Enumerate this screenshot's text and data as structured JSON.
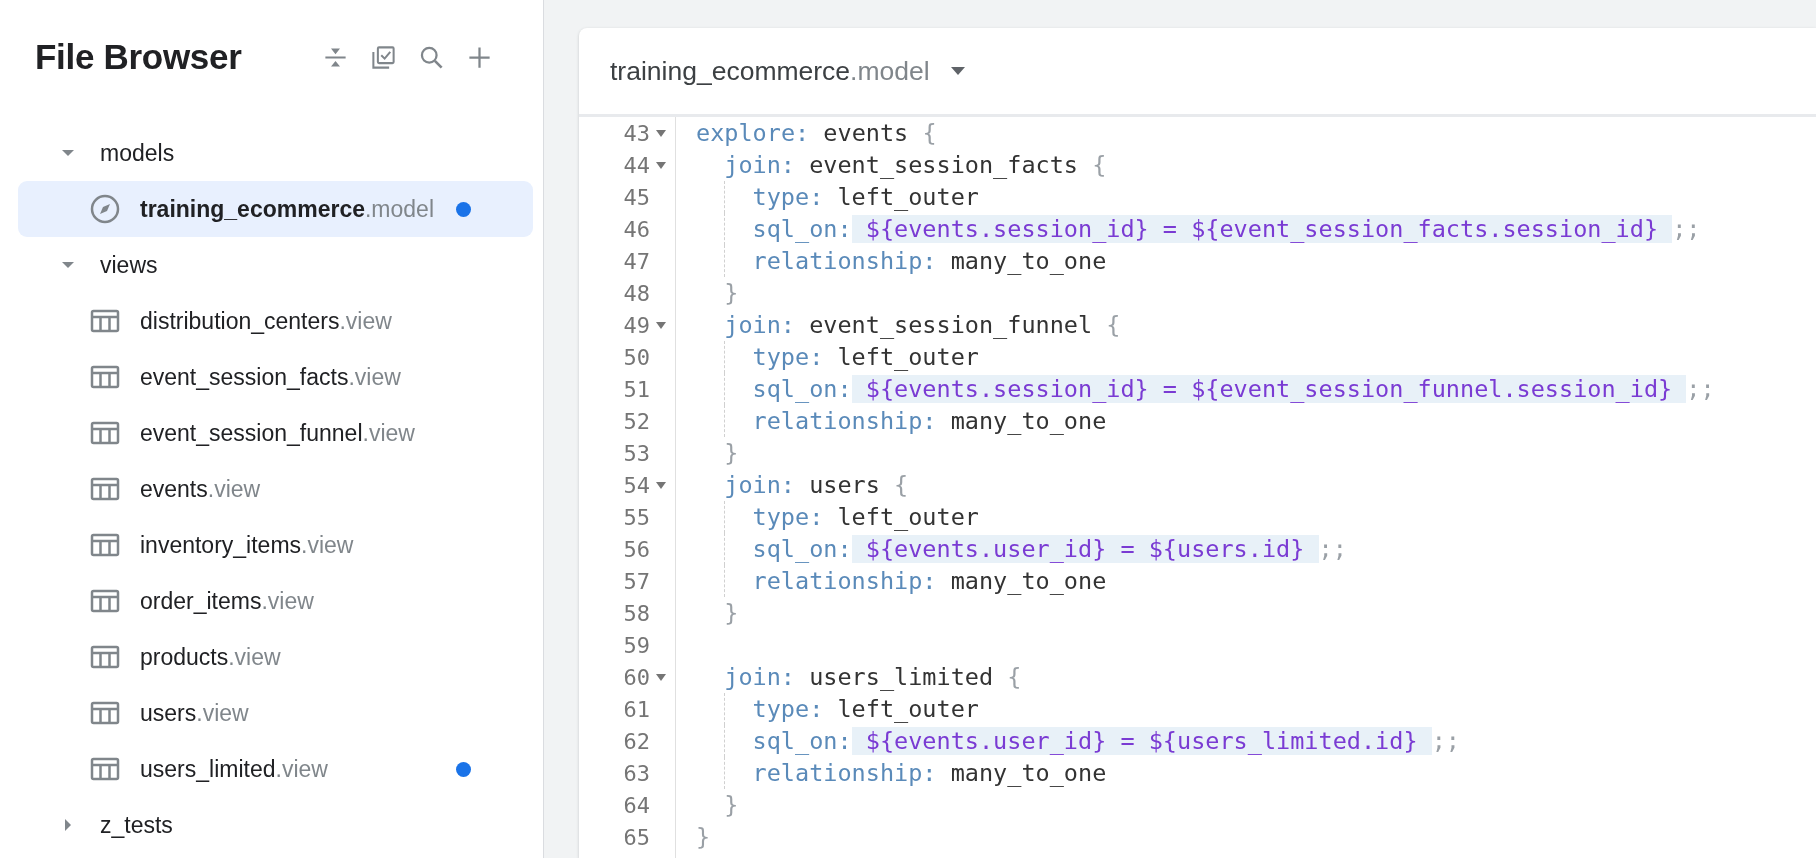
{
  "sidebar": {
    "title": "File Browser",
    "folders": [
      {
        "name": "models",
        "expanded": true,
        "children": [
          {
            "kind": "model",
            "name": "training_ecommerce",
            "extension": ".model",
            "selected": true,
            "modified": true
          }
        ]
      },
      {
        "name": "views",
        "expanded": true,
        "children": [
          {
            "kind": "view",
            "name": "distribution_centers",
            "extension": ".view",
            "selected": false,
            "modified": false
          },
          {
            "kind": "view",
            "name": "event_session_facts",
            "extension": ".view",
            "selected": false,
            "modified": false
          },
          {
            "kind": "view",
            "name": "event_session_funnel",
            "extension": ".view",
            "selected": false,
            "modified": false
          },
          {
            "kind": "view",
            "name": "events",
            "extension": ".view",
            "selected": false,
            "modified": false
          },
          {
            "kind": "view",
            "name": "inventory_items",
            "extension": ".view",
            "selected": false,
            "modified": false
          },
          {
            "kind": "view",
            "name": "order_items",
            "extension": ".view",
            "selected": false,
            "modified": false
          },
          {
            "kind": "view",
            "name": "products",
            "extension": ".view",
            "selected": false,
            "modified": false
          },
          {
            "kind": "view",
            "name": "users",
            "extension": ".view",
            "selected": false,
            "modified": false
          },
          {
            "kind": "view",
            "name": "users_limited",
            "extension": ".view",
            "selected": false,
            "modified": true
          }
        ]
      },
      {
        "name": "z_tests",
        "expanded": false
      }
    ]
  },
  "editor": {
    "file": {
      "name": "training_ecommerce",
      "extension": ".model"
    },
    "lines": [
      {
        "number": "43",
        "foldable": true,
        "segments": [
          {
            "kind": "keyword",
            "text": "explore:"
          },
          {
            "kind": "plain",
            "text": " events "
          },
          {
            "kind": "brace",
            "text": "{"
          }
        ],
        "children": [
          {
            "number": "44",
            "foldable": true,
            "segments": [
              {
                "kind": "keyword",
                "text": "join:"
              },
              {
                "kind": "plain",
                "text": " event_session_facts "
              },
              {
                "kind": "brace",
                "text": "{"
              }
            ],
            "children": [
              {
                "number": "45",
                "foldable": false,
                "segments": [
                  {
                    "kind": "keyword",
                    "text": "type:"
                  },
                  {
                    "kind": "plain",
                    "text": " left_outer"
                  }
                ]
              },
              {
                "number": "46",
                "foldable": false,
                "segments": [
                  {
                    "kind": "keyword",
                    "text": "sql_on:"
                  },
                  {
                    "kind": "sql",
                    "text": " ${events.session_id} = ${event_session_facts.session_id} "
                  },
                  {
                    "kind": "punct",
                    "text": ";;"
                  }
                ]
              },
              {
                "number": "47",
                "foldable": false,
                "segments": [
                  {
                    "kind": "keyword",
                    "text": "relationship:"
                  },
                  {
                    "kind": "plain",
                    "text": " many_to_one"
                  }
                ]
              }
            ]
          },
          {
            "number": "48",
            "foldable": false,
            "segments": [
              {
                "kind": "brace",
                "text": "}"
              }
            ]
          },
          {
            "number": "49",
            "foldable": true,
            "segments": [
              {
                "kind": "keyword",
                "text": "join:"
              },
              {
                "kind": "plain",
                "text": " event_session_funnel "
              },
              {
                "kind": "brace",
                "text": "{"
              }
            ],
            "children": [
              {
                "number": "50",
                "foldable": false,
                "segments": [
                  {
                    "kind": "keyword",
                    "text": "type:"
                  },
                  {
                    "kind": "plain",
                    "text": " left_outer"
                  }
                ]
              },
              {
                "number": "51",
                "foldable": false,
                "segments": [
                  {
                    "kind": "keyword",
                    "text": "sql_on:"
                  },
                  {
                    "kind": "sql",
                    "text": " ${events.session_id} = ${event_session_funnel.session_id} "
                  },
                  {
                    "kind": "punct",
                    "text": ";;"
                  }
                ]
              },
              {
                "number": "52",
                "foldable": false,
                "segments": [
                  {
                    "kind": "keyword",
                    "text": "relationship:"
                  },
                  {
                    "kind": "plain",
                    "text": " many_to_one"
                  }
                ]
              }
            ]
          },
          {
            "number": "53",
            "foldable": false,
            "segments": [
              {
                "kind": "brace",
                "text": "}"
              }
            ]
          },
          {
            "number": "54",
            "foldable": true,
            "segments": [
              {
                "kind": "keyword",
                "text": "join:"
              },
              {
                "kind": "plain",
                "text": " users "
              },
              {
                "kind": "brace",
                "text": "{"
              }
            ],
            "children": [
              {
                "number": "55",
                "foldable": false,
                "segments": [
                  {
                    "kind": "keyword",
                    "text": "type:"
                  },
                  {
                    "kind": "plain",
                    "text": " left_outer"
                  }
                ]
              },
              {
                "number": "56",
                "foldable": false,
                "segments": [
                  {
                    "kind": "keyword",
                    "text": "sql_on:"
                  },
                  {
                    "kind": "sql",
                    "text": " ${events.user_id} = ${users.id} "
                  },
                  {
                    "kind": "punct",
                    "text": ";;"
                  }
                ]
              },
              {
                "number": "57",
                "foldable": false,
                "segments": [
                  {
                    "kind": "keyword",
                    "text": "relationship:"
                  },
                  {
                    "kind": "plain",
                    "text": " many_to_one"
                  }
                ]
              }
            ]
          },
          {
            "number": "58",
            "foldable": false,
            "segments": [
              {
                "kind": "brace",
                "text": "}"
              }
            ]
          },
          {
            "number": "59",
            "foldable": false
          },
          {
            "number": "60",
            "foldable": true,
            "segments": [
              {
                "kind": "keyword",
                "text": "join:"
              },
              {
                "kind": "plain",
                "text": " users_limited "
              },
              {
                "kind": "brace",
                "text": "{"
              }
            ],
            "children": [
              {
                "number": "61",
                "foldable": false,
                "segments": [
                  {
                    "kind": "keyword",
                    "text": "type:"
                  },
                  {
                    "kind": "plain",
                    "text": " left_outer"
                  }
                ]
              },
              {
                "number": "62",
                "foldable": false,
                "segments": [
                  {
                    "kind": "keyword",
                    "text": "sql_on:"
                  },
                  {
                    "kind": "sql",
                    "text": " ${events.user_id} = ${users_limited.id} "
                  },
                  {
                    "kind": "punct",
                    "text": ";;"
                  }
                ]
              },
              {
                "number": "63",
                "foldable": false,
                "segments": [
                  {
                    "kind": "keyword",
                    "text": "relationship:"
                  },
                  {
                    "kind": "plain",
                    "text": " many_to_one"
                  }
                ]
              }
            ]
          },
          {
            "number": "64",
            "foldable": false,
            "segments": [
              {
                "kind": "brace",
                "text": "}"
              }
            ]
          }
        ]
      },
      {
        "number": "65",
        "foldable": false,
        "segments": [
          {
            "kind": "brace",
            "text": "}"
          }
        ]
      }
    ]
  }
}
